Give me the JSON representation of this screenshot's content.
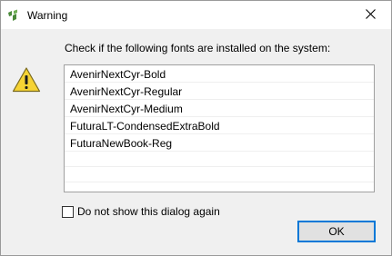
{
  "window": {
    "title": "Warning",
    "app_icon": "app-logo-icon",
    "close_icon": "close-icon"
  },
  "message": "Check if the following fonts are installed on the system:",
  "icon": "warning-icon",
  "fonts_list": [
    "AvenirNextCyr-Bold",
    "AvenirNextCyr-Regular",
    "AvenirNextCyr-Medium",
    "FuturaLT-CondensedExtraBold",
    "FuturaNewBook-Reg"
  ],
  "checkbox": {
    "label": "Do not show this dialog again",
    "checked": false
  },
  "ok_button": {
    "label": "OK"
  },
  "colors": {
    "accent": "#0078d7",
    "warning_yellow": "#f6d334",
    "app_icon_green": "#4a8a3a"
  }
}
